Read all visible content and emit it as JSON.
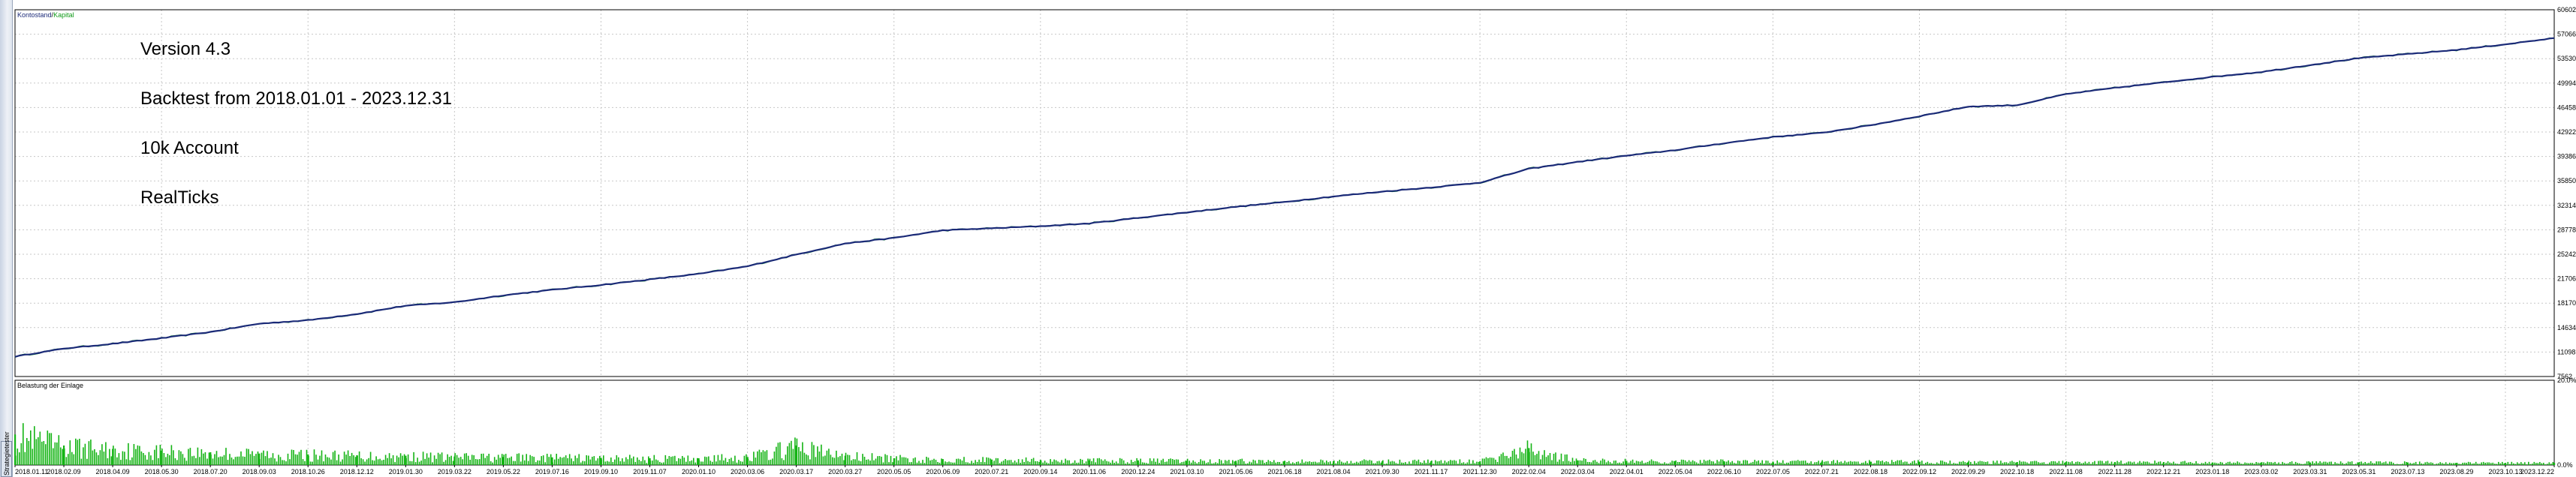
{
  "colors": {
    "balance": "#1b2a78",
    "equity": "#109a18",
    "load": "#14b414",
    "grid": "#c7c7c7",
    "frame": "#000000"
  },
  "tester_tab": {
    "label": "Strategietester"
  },
  "captions": {
    "version": "Version 4.3",
    "backtest": "Backtest from 2018.01.01 - 2023.12.31",
    "account": "10k Account",
    "ticks": "RealTicks"
  },
  "chart_data": [
    {
      "type": "line",
      "title": "",
      "legend": {
        "position": "top-left",
        "items": [
          "Kontostand",
          "Kapital"
        ],
        "separator": " / "
      },
      "series": [
        {
          "name": "Kontostand",
          "color": "#1b2a78"
        },
        {
          "name": "Kapital",
          "color": "#109a18"
        }
      ],
      "y_ticks": [
        "60602",
        "57066",
        "53530",
        "49994",
        "46458",
        "42922",
        "39386",
        "35850",
        "32314",
        "28778",
        "25242",
        "21706",
        "18170",
        "14634",
        "11098",
        "7562"
      ],
      "ylim": [
        7562,
        60602
      ],
      "x": [
        "2018.01.11",
        "2018.02.09",
        "2018.04.09",
        "2018.05.30",
        "2018.07.20",
        "2018.09.03",
        "2018.10.26",
        "2018.12.12",
        "2019.01.30",
        "2019.03.22",
        "2019.05.22",
        "2019.07.16",
        "2019.09.10",
        "2019.11.07",
        "2020.01.10",
        "2020.03.06",
        "2020.03.17",
        "2020.03.27",
        "2020.05.05",
        "2020.06.09",
        "2020.07.21",
        "2020.09.14",
        "2020.11.06",
        "2020.12.24",
        "2021.03.10",
        "2021.05.06",
        "2021.06.18",
        "2021.08.04",
        "2021.09.30",
        "2021.11.17",
        "2021.12.30",
        "2022.02.04",
        "2022.03.04",
        "2022.04.01",
        "2022.05.04",
        "2022.06.10",
        "2022.07.05",
        "2022.07.21",
        "2022.08.18",
        "2022.09.12",
        "2022.09.29",
        "2022.10.18",
        "2022.11.08",
        "2022.11.28",
        "2022.12.21",
        "2023.01.18",
        "2023.03.02",
        "2023.03.31",
        "2023.05.31",
        "2023.07.13",
        "2023.08.29",
        "2023.10.13",
        "2023.12.22"
      ],
      "values": [
        10450,
        11600,
        12300,
        13100,
        14000,
        15200,
        15700,
        16600,
        17800,
        18300,
        19300,
        20100,
        20800,
        21600,
        22400,
        23500,
        25200,
        26800,
        27600,
        28700,
        29000,
        29300,
        29700,
        30500,
        31300,
        32100,
        32800,
        33600,
        34300,
        34900,
        35600,
        37600,
        38600,
        39500,
        40300,
        41300,
        42200,
        42800,
        43900,
        45200,
        46600,
        46800,
        48400,
        49300,
        50100,
        50900,
        51600,
        52600,
        53600,
        54200,
        54800,
        55600,
        56500
      ]
    },
    {
      "type": "bar",
      "title": "Belastung der Einlage",
      "series": [
        {
          "name": "Belastung der Einlage",
          "color": "#14b414"
        }
      ],
      "y_ticks": [
        "20.0%",
        "0.0%"
      ],
      "ylim": [
        0,
        20
      ],
      "x": [
        "2018.01.11",
        "2018.02.09",
        "2018.04.09",
        "2018.05.30",
        "2018.07.20",
        "2018.09.03",
        "2018.10.26",
        "2018.12.12",
        "2019.01.30",
        "2019.03.22",
        "2019.05.22",
        "2019.07.16",
        "2019.09.10",
        "2019.11.07",
        "2020.01.10",
        "2020.03.06",
        "2020.03.17",
        "2020.03.27",
        "2020.05.05",
        "2020.06.09",
        "2020.07.21",
        "2020.09.14",
        "2020.11.06",
        "2020.12.24",
        "2021.03.10",
        "2021.05.06",
        "2021.06.18",
        "2021.08.04",
        "2021.09.30",
        "2021.11.17",
        "2021.12.30",
        "2022.02.04",
        "2022.03.04",
        "2022.04.01",
        "2022.05.04",
        "2022.06.10",
        "2022.07.05",
        "2022.07.21",
        "2022.08.18",
        "2022.09.12",
        "2022.09.29",
        "2022.10.18",
        "2022.11.08",
        "2022.11.28",
        "2022.12.21",
        "2023.01.18",
        "2023.03.02",
        "2023.03.31",
        "2023.05.31",
        "2023.07.13",
        "2023.08.29",
        "2023.10.13",
        "2023.12.22"
      ],
      "values": [
        7.2,
        4.6,
        3.8,
        3.4,
        3.0,
        2.7,
        2.5,
        2.3,
        2.2,
        2.0,
        1.9,
        1.8,
        1.7,
        1.6,
        1.6,
        1.9,
        4.6,
        2.2,
        1.6,
        1.4,
        1.3,
        1.2,
        1.1,
        1.1,
        1.0,
        1.0,
        1.0,
        0.9,
        0.9,
        0.9,
        0.9,
        4.0,
        1.1,
        1.0,
        0.9,
        0.9,
        0.8,
        0.8,
        0.8,
        0.8,
        0.7,
        0.7,
        0.7,
        0.7,
        0.7,
        0.6,
        0.6,
        0.6,
        0.6,
        0.6,
        0.5,
        0.5,
        0.5
      ]
    }
  ]
}
